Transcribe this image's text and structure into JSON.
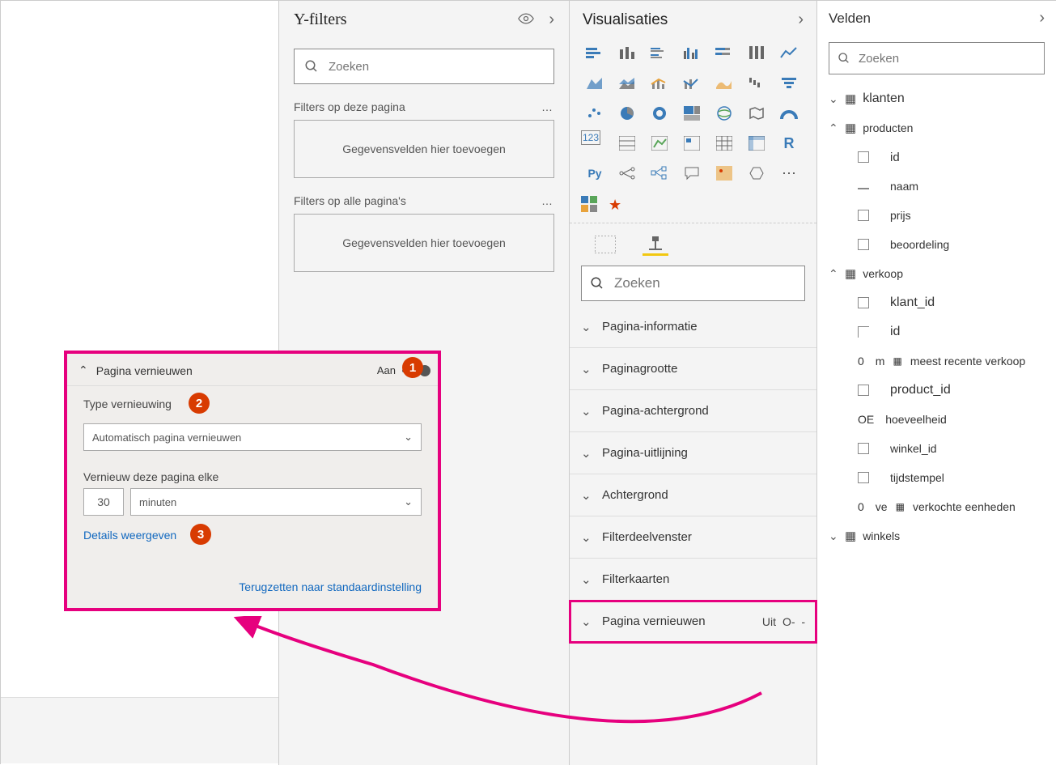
{
  "filters": {
    "title": "Y-filters",
    "search_placeholder": "Zoeken",
    "section_page": "Filters op deze pagina",
    "section_all": "Filters op alle pagina's",
    "dropzone_text": "Gegevensvelden hier toevoegen"
  },
  "viz": {
    "title": "Visualisaties",
    "search_placeholder": "Zoeken",
    "sections": [
      "Pagina-informatie",
      "Paginagrootte",
      "Pagina-achtergrond",
      "Pagina-uitlijning",
      "Achtergrond",
      "Filterdeelvenster",
      "Filterkaarten"
    ],
    "refresh_section": "Pagina vernieuwen",
    "refresh_state": "Uit",
    "r_label": "R",
    "py_label": "Py"
  },
  "fields": {
    "title": "Velden",
    "search_placeholder": "Zoeken",
    "tables": {
      "klanten": "klanten",
      "producten": {
        "name": "producten",
        "cols": [
          "id",
          "naam",
          "prijs",
          "beoordeling"
        ]
      },
      "verkoop": {
        "name": "verkoop",
        "cols": [
          "klant_id",
          "id"
        ],
        "meest_recente": "meest recente verkoop",
        "product_id": "product_id",
        "hoeveelheid": "hoeveelheid",
        "winkel_id": "winkel_id",
        "tijdstempel": "tijdstempel",
        "verkochte": "verkochte eenheden",
        "zero": "0",
        "oe": "OE"
      },
      "winkels": "winkels"
    }
  },
  "callout": {
    "title": "Pagina vernieuwen",
    "toggle_state": "Aan",
    "type_label": "Type vernieuwing",
    "type_value": "Automatisch pagina vernieuwen",
    "interval_label": "Vernieuw deze pagina elke",
    "interval_value": "30",
    "interval_unit": "minuten",
    "details_link": "Details weergeven",
    "reset_link": "Terugzetten naar standaardinstelling",
    "badge1": "1",
    "badge2": "2",
    "badge3": "3"
  }
}
